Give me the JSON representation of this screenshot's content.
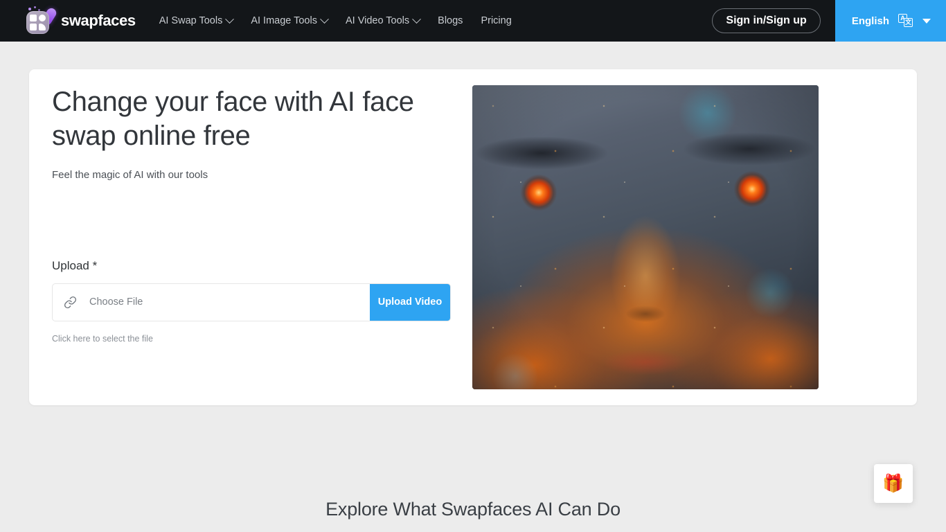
{
  "header": {
    "brand": {
      "name": "swapfaces",
      "logo_icon": "swapfaces-logo-icon"
    },
    "nav": [
      {
        "label": "AI Swap Tools",
        "has_dropdown": true
      },
      {
        "label": "AI Image Tools",
        "has_dropdown": true
      },
      {
        "label": "AI Video Tools",
        "has_dropdown": true
      },
      {
        "label": "Blogs",
        "has_dropdown": false
      },
      {
        "label": "Pricing",
        "has_dropdown": false
      }
    ],
    "signin_label": "Sign in/Sign up",
    "language": {
      "label": "English",
      "translate_icon": "translate-icon",
      "caret_icon": "caret-down-icon",
      "icon_letter_a": "A",
      "icon_letter_cjk": "文"
    },
    "background_color": "#131619",
    "accent_color": "#2ea4f2"
  },
  "hero": {
    "title": "Change your face with AI face swap online free",
    "subtitle": "Feel the magic of AI with our tools",
    "upload": {
      "label": "Upload *",
      "link_icon": "link-icon",
      "choose_file_placeholder": "Choose File",
      "choose_file_value": "",
      "button_label": "Upload Video",
      "hint": "Click here to select the file"
    },
    "image_alt": "AI generated face with glowing orange eyes and light particles"
  },
  "section": {
    "title": "Explore What Swapfaces AI Can Do"
  },
  "gift_widget": {
    "icon": "🎁",
    "name": "gift-icon"
  },
  "colors": {
    "page_background": "#ececec",
    "card_background": "#ffffff",
    "accent_blue": "#2ea4f2",
    "text_primary": "#32363b",
    "text_muted": "#8b9097"
  }
}
